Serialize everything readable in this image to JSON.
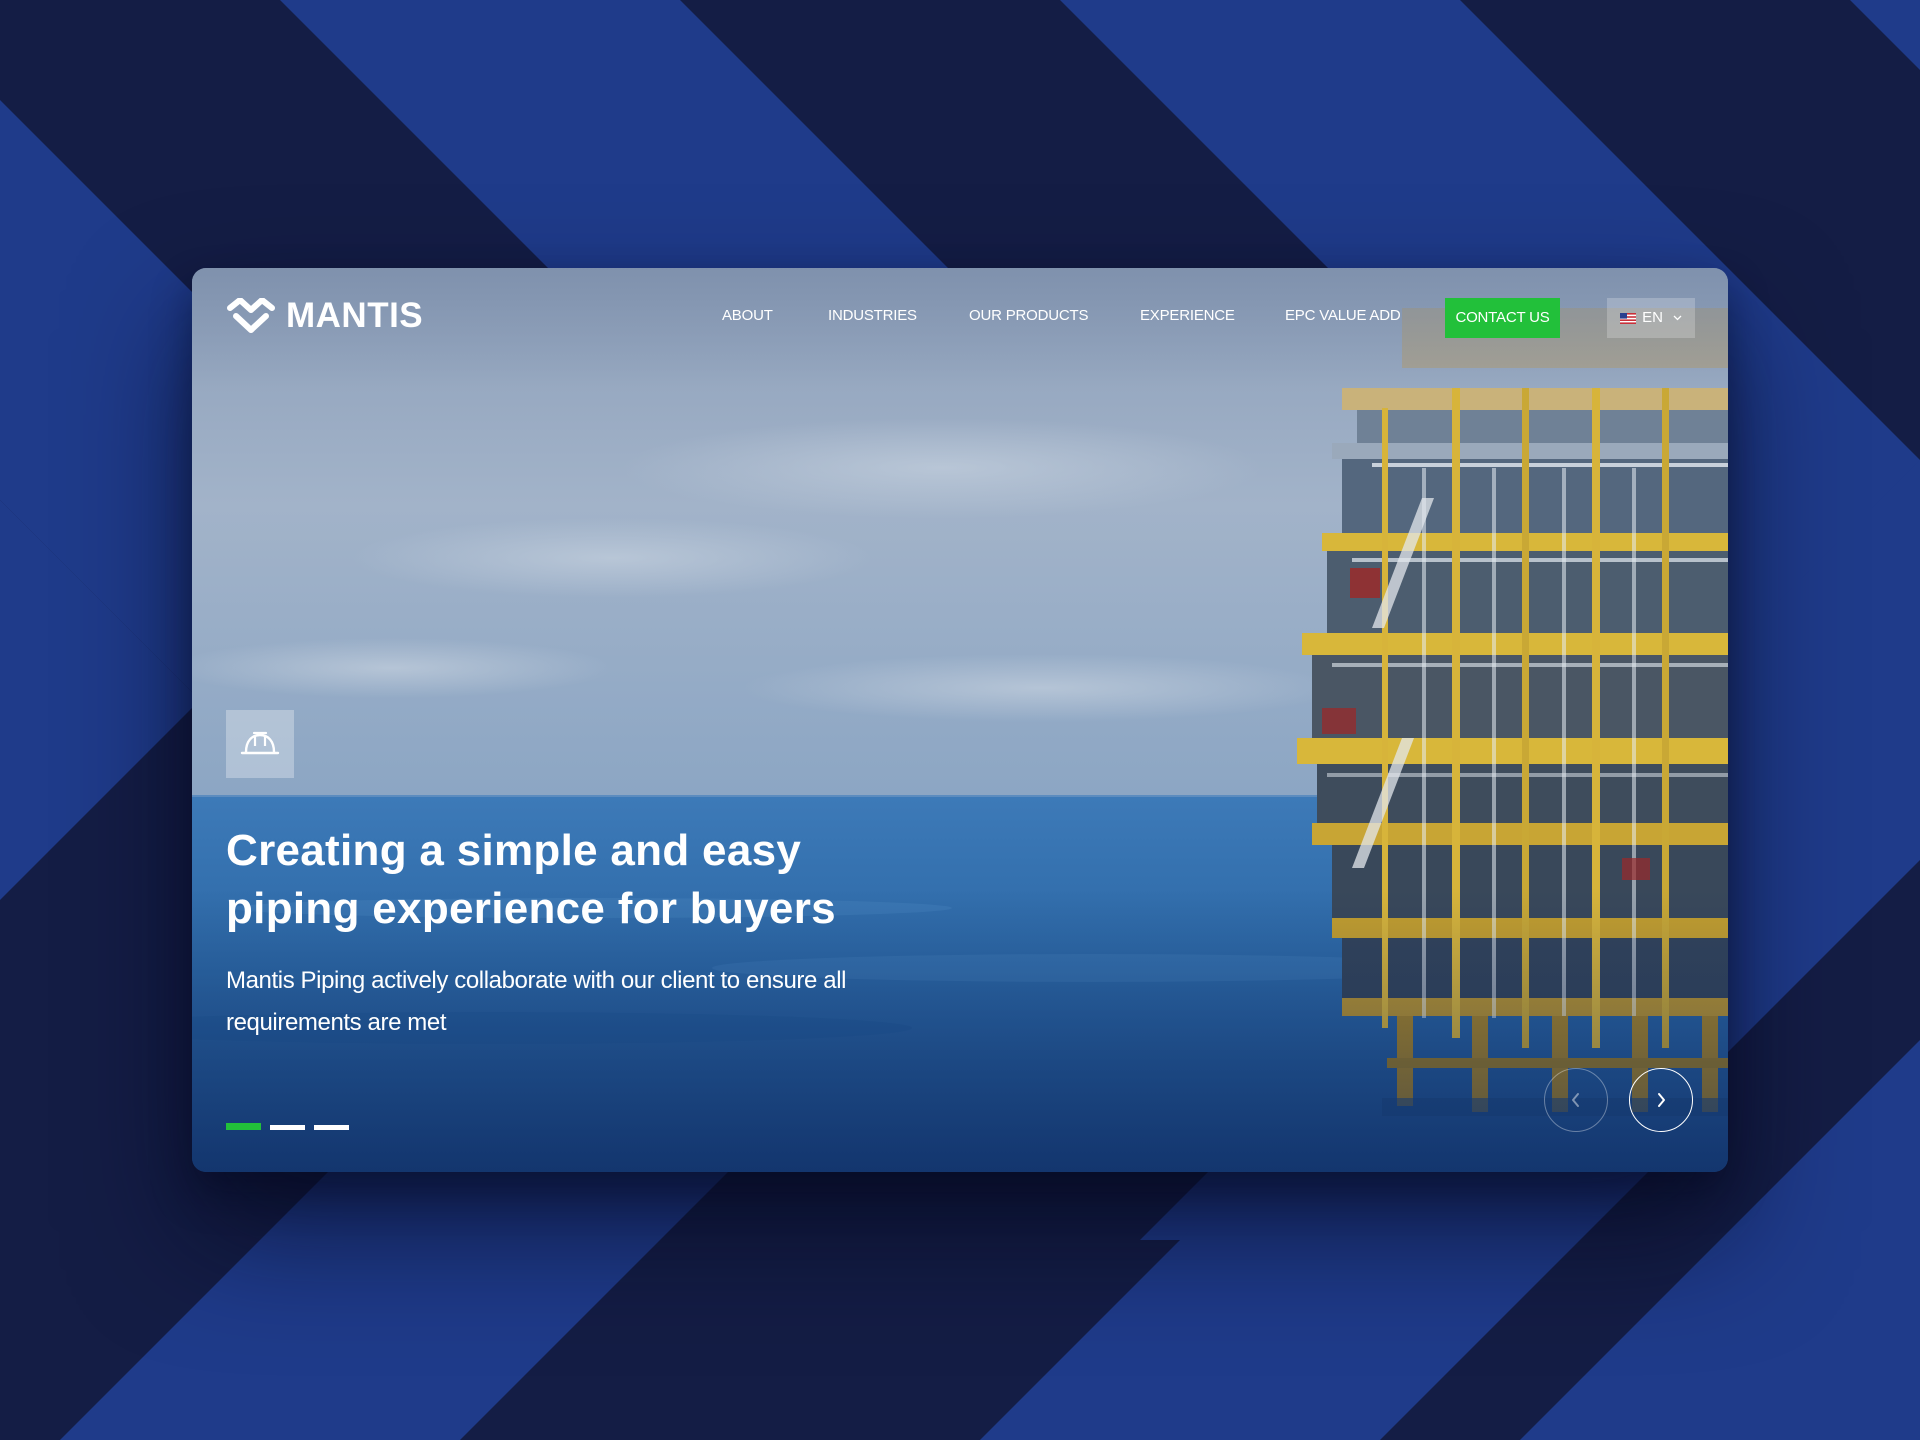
{
  "brand": {
    "name": "MANTIS",
    "logo_icon": "mantis-logo-mark"
  },
  "nav": {
    "items": [
      {
        "label": "ABOUT"
      },
      {
        "label": "INDUSTRIES"
      },
      {
        "label": "OUR PRODUCTS"
      },
      {
        "label": "EXPERIENCE"
      },
      {
        "label": "EPC VALUE ADD"
      }
    ],
    "contact_label": "CONTACT US",
    "language": {
      "flag_icon": "us-flag-icon",
      "label": "EN",
      "dropdown_icon": "chevron-down-icon"
    }
  },
  "hero": {
    "badge_icon": "hard-hat-icon",
    "title_line1": "Creating a simple and easy",
    "title_line2": "piping experience for buyers",
    "subtitle_line1": "Mantis Piping actively collaborate with our client to ensure all",
    "subtitle_line2": "requirements are met",
    "slides": {
      "count": 3,
      "active_index": 0
    },
    "prev_icon": "chevron-left-icon",
    "next_icon": "chevron-right-icon"
  },
  "colors": {
    "accent_green": "#22c03a",
    "background_navy": "#141d45",
    "background_blue": "#1f3b8a",
    "sky": "#9fb0c6",
    "sea": "#2a6aa6",
    "platform_yellow": "#d9b52a"
  }
}
